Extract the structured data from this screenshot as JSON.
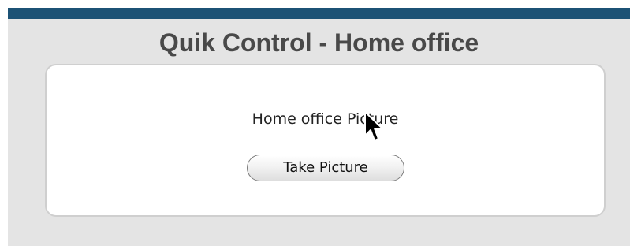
{
  "header": {
    "title": "Quik Control - Home office",
    "bar_color": "#1c5275"
  },
  "main": {
    "picture_label": "Home office Picture",
    "take_picture_button_label": "Take Picture"
  },
  "icons": {
    "cursor": "mouse-pointer-arrow"
  }
}
